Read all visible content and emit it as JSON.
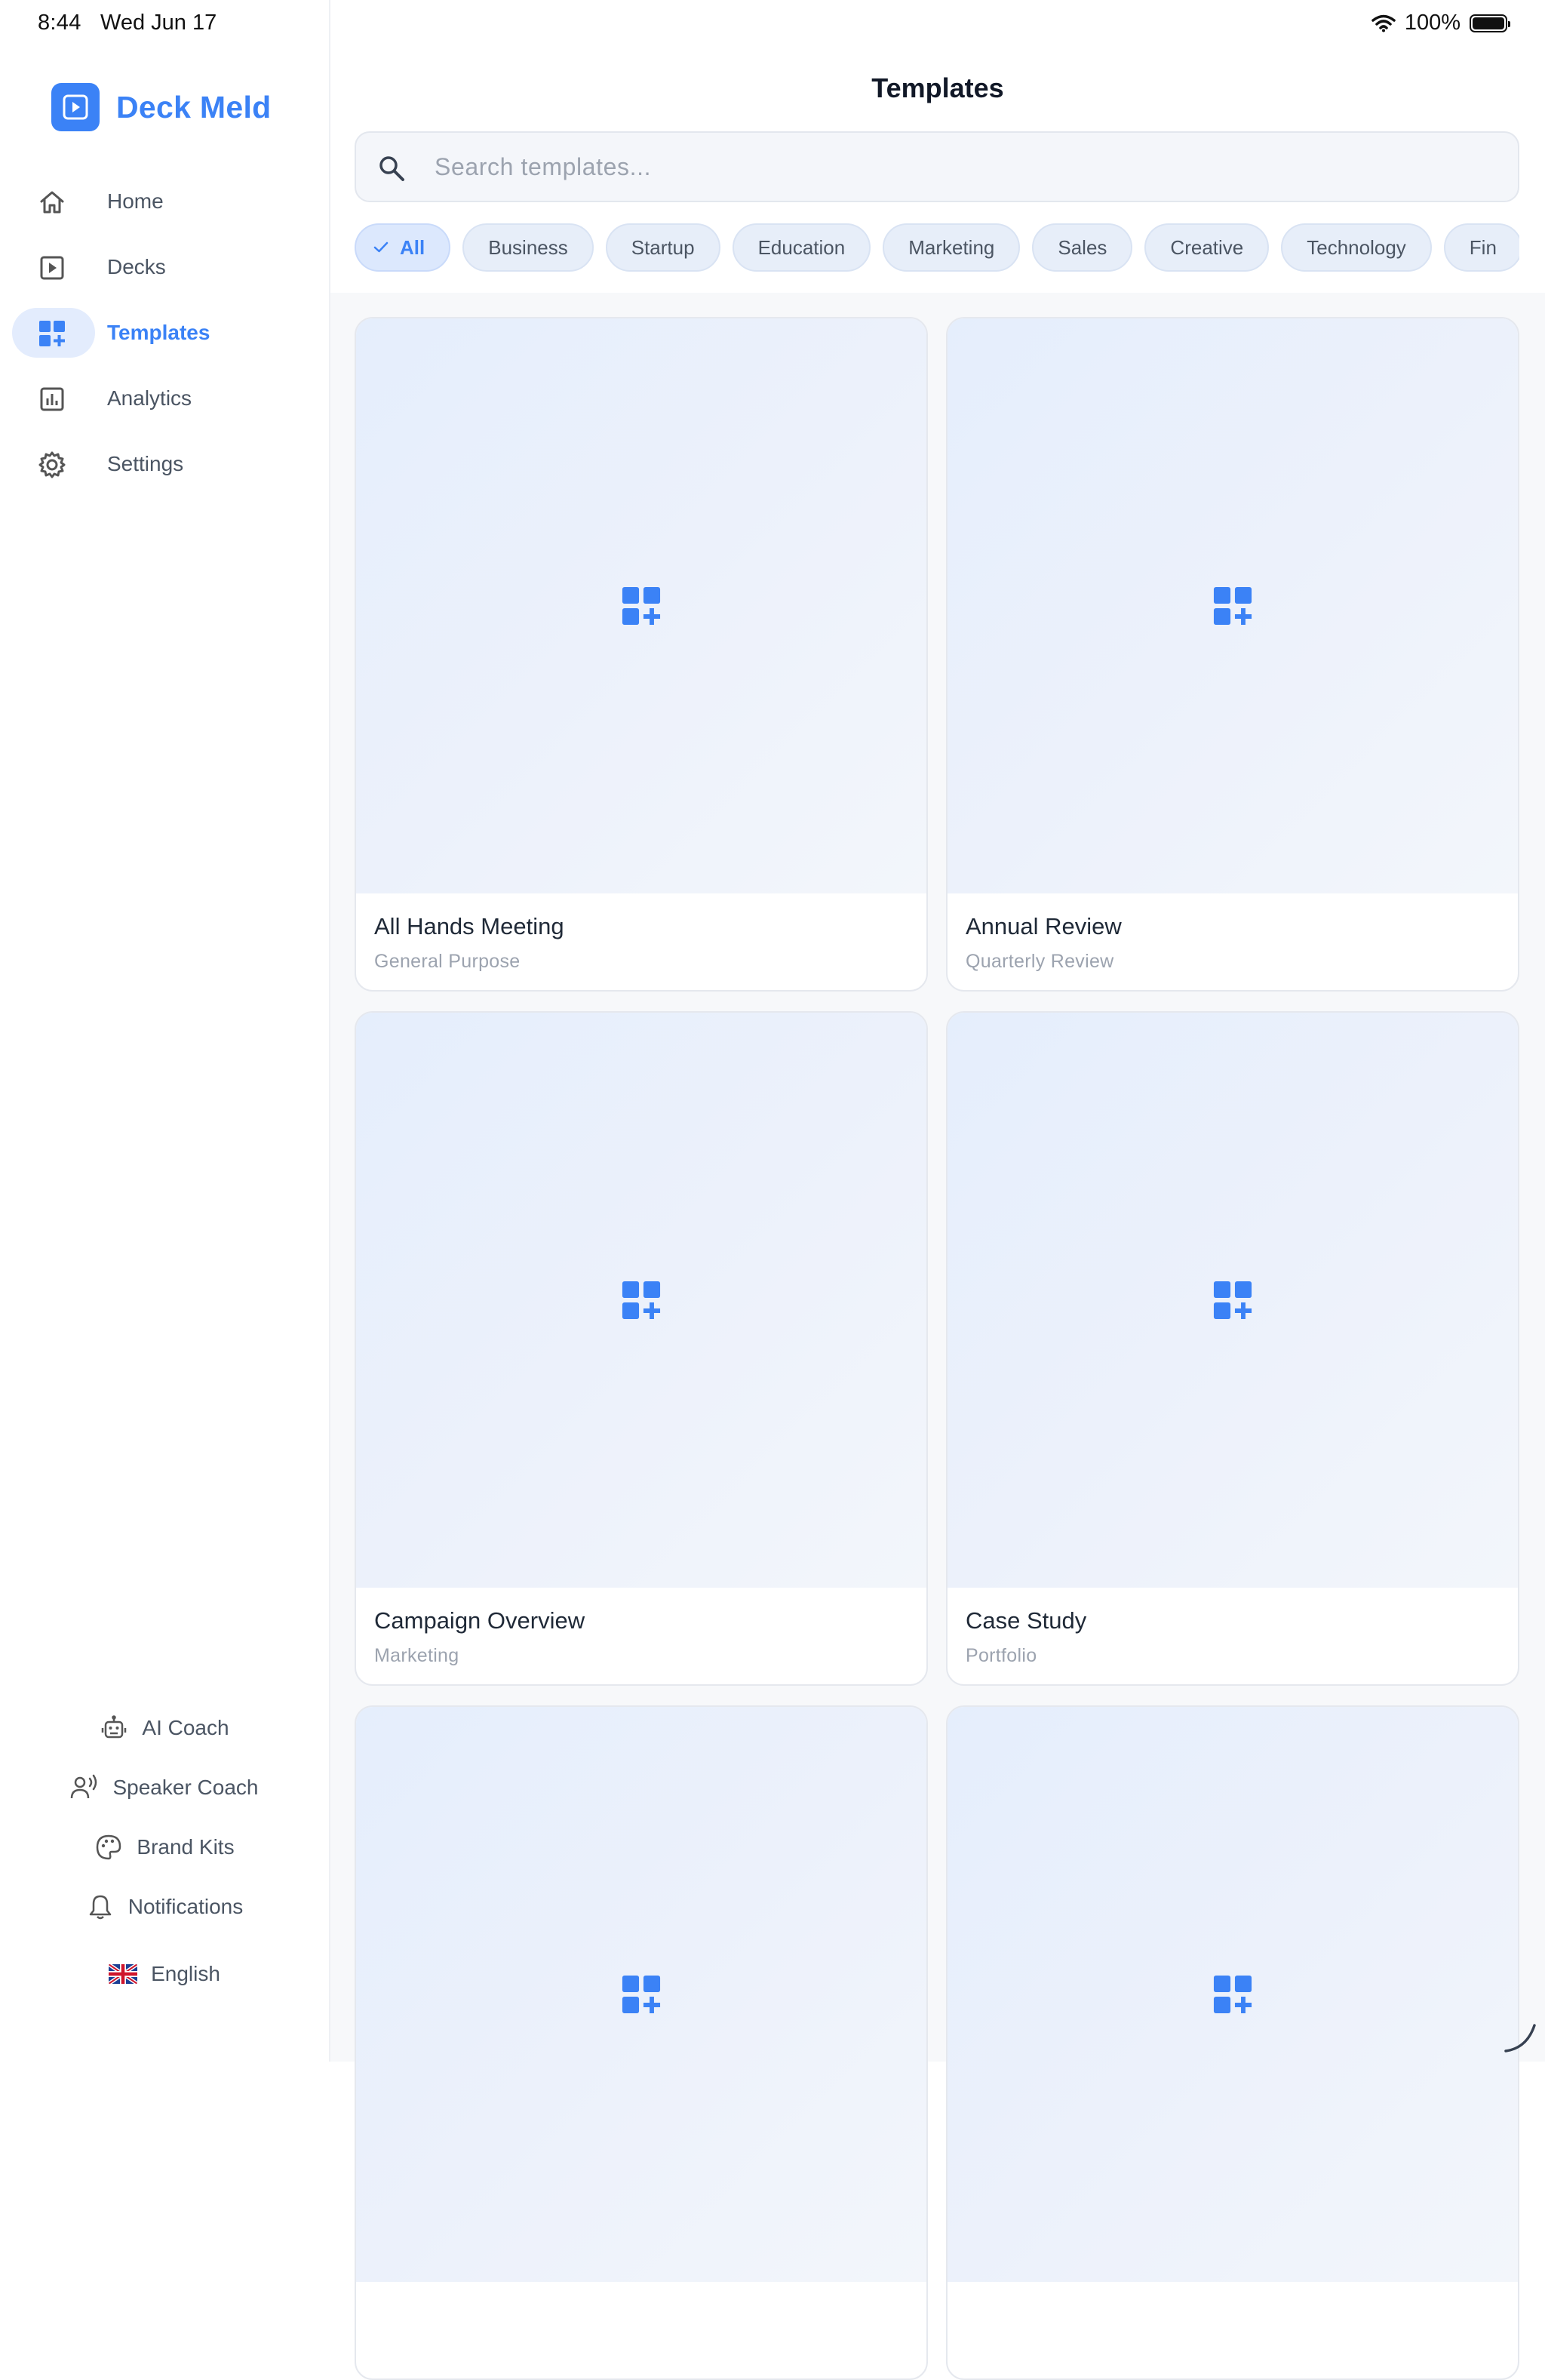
{
  "status_bar": {
    "time": "8:44",
    "date": "Wed Jun 17",
    "battery": "100%"
  },
  "brand": {
    "name": "Deck Meld",
    "color": "#3b82f6"
  },
  "sidebar": {
    "items": [
      {
        "label": "Home",
        "icon": "home-icon",
        "active": false
      },
      {
        "label": "Decks",
        "icon": "play-square-icon",
        "active": false
      },
      {
        "label": "Templates",
        "icon": "grid-plus-icon",
        "active": true
      },
      {
        "label": "Analytics",
        "icon": "bar-chart-icon",
        "active": false
      },
      {
        "label": "Settings",
        "icon": "gear-icon",
        "active": false
      }
    ],
    "bottom_links": [
      {
        "label": "AI Coach",
        "icon": "robot-icon"
      },
      {
        "label": "Speaker Coach",
        "icon": "speaker-icon"
      },
      {
        "label": "Brand Kits",
        "icon": "palette-icon"
      },
      {
        "label": "Notifications",
        "icon": "bell-icon"
      }
    ],
    "language": {
      "label": "English",
      "icon": "uk-flag-icon"
    }
  },
  "main": {
    "title": "Templates",
    "search": {
      "placeholder": "Search templates..."
    },
    "filters": [
      "All",
      "Business",
      "Startup",
      "Education",
      "Marketing",
      "Sales",
      "Creative",
      "Technology",
      "Fin"
    ],
    "active_filter": "All",
    "templates": [
      {
        "name": "All Hands Meeting",
        "category": "General Purpose"
      },
      {
        "name": "Annual Review",
        "category": "Quarterly Review"
      },
      {
        "name": "Campaign Overview",
        "category": "Marketing"
      },
      {
        "name": "Case Study",
        "category": "Portfolio"
      },
      {
        "name": "",
        "category": ""
      },
      {
        "name": "",
        "category": ""
      }
    ]
  }
}
